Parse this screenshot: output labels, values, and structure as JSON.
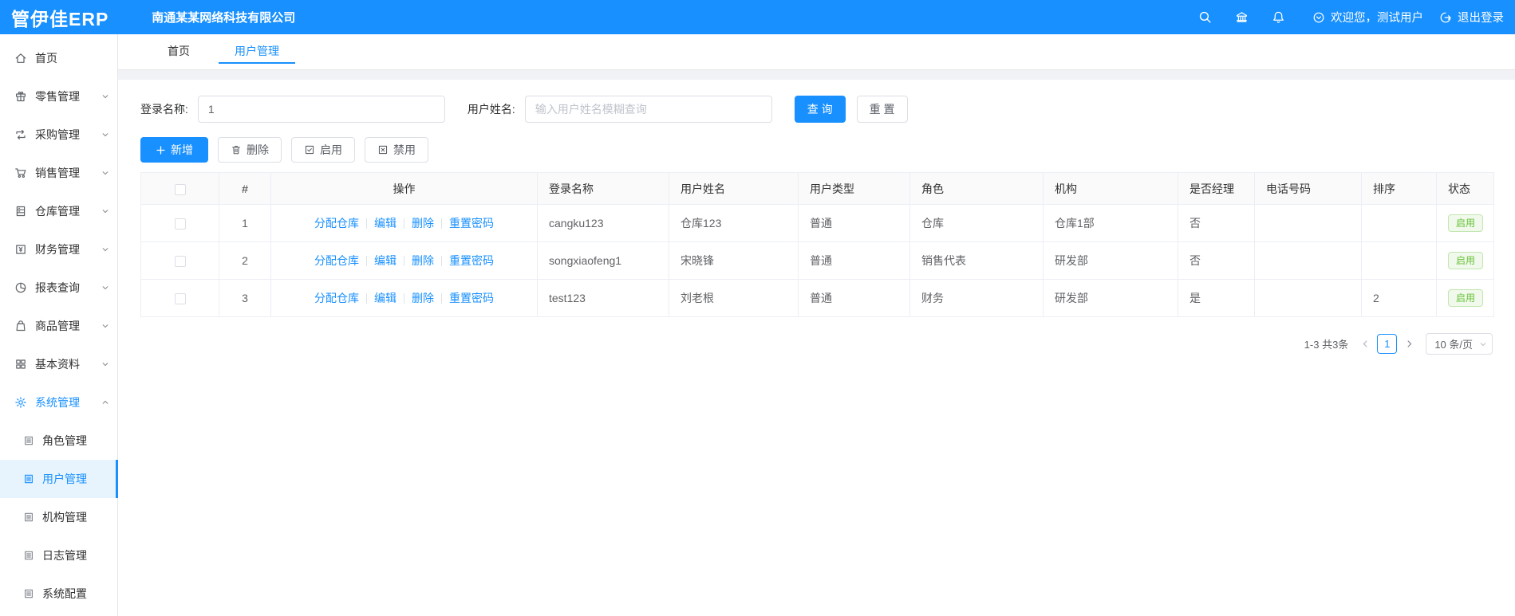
{
  "header": {
    "logo": "管伊佳ERP",
    "company": "南通某某网络科技有限公司",
    "welcome": "欢迎您，测试用户",
    "logout": "退出登录"
  },
  "colors": {
    "primary": "#1890ff",
    "success": "#67c23a",
    "success_bg": "#f0f9eb",
    "success_border": "#c2e7b0",
    "sidebar_active_bg": "#e7f4fe",
    "page_bg": "#f0f2f5",
    "table_header_bg": "#fafafa",
    "table_border": "#ebeef5"
  },
  "icons": {
    "search-icon": "magnifier",
    "bank-icon": "bank-building",
    "bell-icon": "bell",
    "welcome-icon": "circle-chevron-down",
    "logout-icon": "circle-arrow-right",
    "home-icon": "house",
    "retail-icon": "gift-box",
    "purchase-icon": "sync-arrows",
    "sales-icon": "shopping-cart",
    "warehouse-icon": "cabinet",
    "finance-icon": "bill-yuan",
    "report-icon": "pie-chart",
    "goods-icon": "shopping-bag",
    "basic-icon": "grid-squares",
    "system-icon": "gear",
    "submenu-icon": "document",
    "add-icon": "plus",
    "delete-icon": "trash",
    "enable-icon": "check-square",
    "disable-icon": "x-square",
    "chevron-down-icon": "∨",
    "chevron-up-icon": "∧",
    "prev-icon": "‹",
    "next-icon": "›"
  },
  "sidebar": {
    "items": [
      {
        "label": "首页",
        "icon": "home",
        "has_children": false
      },
      {
        "label": "零售管理",
        "icon": "retail",
        "has_children": true
      },
      {
        "label": "采购管理",
        "icon": "purchase",
        "has_children": true
      },
      {
        "label": "销售管理",
        "icon": "sales",
        "has_children": true
      },
      {
        "label": "仓库管理",
        "icon": "warehouse",
        "has_children": true
      },
      {
        "label": "财务管理",
        "icon": "finance",
        "has_children": true
      },
      {
        "label": "报表查询",
        "icon": "report",
        "has_children": true
      },
      {
        "label": "商品管理",
        "icon": "goods",
        "has_children": true
      },
      {
        "label": "基本资料",
        "icon": "basic",
        "has_children": true
      },
      {
        "label": "系统管理",
        "icon": "system",
        "has_children": true,
        "expanded": true,
        "active": true
      }
    ],
    "sub_items": [
      {
        "label": "角色管理",
        "active": false
      },
      {
        "label": "用户管理",
        "active": true
      },
      {
        "label": "机构管理",
        "active": false
      },
      {
        "label": "日志管理",
        "active": false
      },
      {
        "label": "系统配置",
        "active": false
      }
    ]
  },
  "tabs": [
    {
      "label": "首页",
      "active": false
    },
    {
      "label": "用户管理",
      "active": true
    }
  ],
  "filters": {
    "login_name_label": "登录名称:",
    "login_name_value": "1",
    "user_name_label": "用户姓名:",
    "user_name_placeholder": "输入用户姓名模糊查询",
    "search_button": "查 询",
    "reset_button": "重 置"
  },
  "toolbar": {
    "add": "新增",
    "delete": "删除",
    "enable": "启用",
    "disable": "禁用"
  },
  "table": {
    "headers": [
      "",
      "#",
      "操作",
      "登录名称",
      "用户姓名",
      "用户类型",
      "角色",
      "机构",
      "是否经理",
      "电话号码",
      "排序",
      "状态"
    ],
    "action_labels": [
      "分配仓库",
      "编辑",
      "删除",
      "重置密码"
    ],
    "rows": [
      {
        "index": "1",
        "login_name": "cangku123",
        "user_name": "仓库123",
        "user_type": "普通",
        "role": "仓库",
        "org": "仓库1部",
        "is_manager": "否",
        "phone": "",
        "sort": "",
        "status": "启用"
      },
      {
        "index": "2",
        "login_name": "songxiaofeng1",
        "user_name": "宋晓锋",
        "user_type": "普通",
        "role": "销售代表",
        "org": "研发部",
        "is_manager": "否",
        "phone": "",
        "sort": "",
        "status": "启用"
      },
      {
        "index": "3",
        "login_name": "test123",
        "user_name": "刘老根",
        "user_type": "普通",
        "role": "财务",
        "org": "研发部",
        "is_manager": "是",
        "phone": "",
        "sort": "2",
        "status": "启用"
      }
    ]
  },
  "pagination": {
    "total_text": "1-3 共3条",
    "current_page": "1",
    "page_size": "10 条/页"
  }
}
